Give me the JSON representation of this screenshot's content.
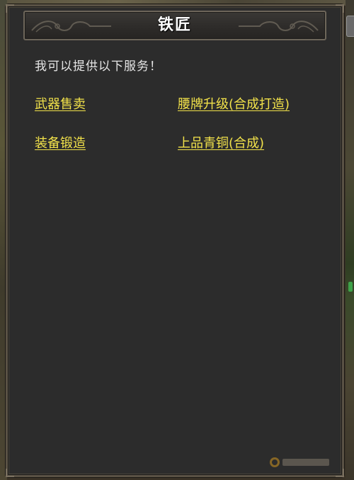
{
  "dialog": {
    "title": "铁匠",
    "intro": "我可以提供以下服务！",
    "options": [
      {
        "label": "武器售卖"
      },
      {
        "label": "腰牌升级(合成打造)"
      },
      {
        "label": "装备锻造"
      },
      {
        "label": "上品青铜(合成)"
      }
    ]
  },
  "colors": {
    "panel": "#2c2c2c",
    "border": "#5a5245",
    "option_text": "#f2e24a",
    "intro_text": "#e6e6e6",
    "title_text": "#ffffff"
  },
  "icons": {
    "title_ornament": "cloud-scroll-ornament-icon",
    "watermark": "watermark-logo-icon"
  }
}
